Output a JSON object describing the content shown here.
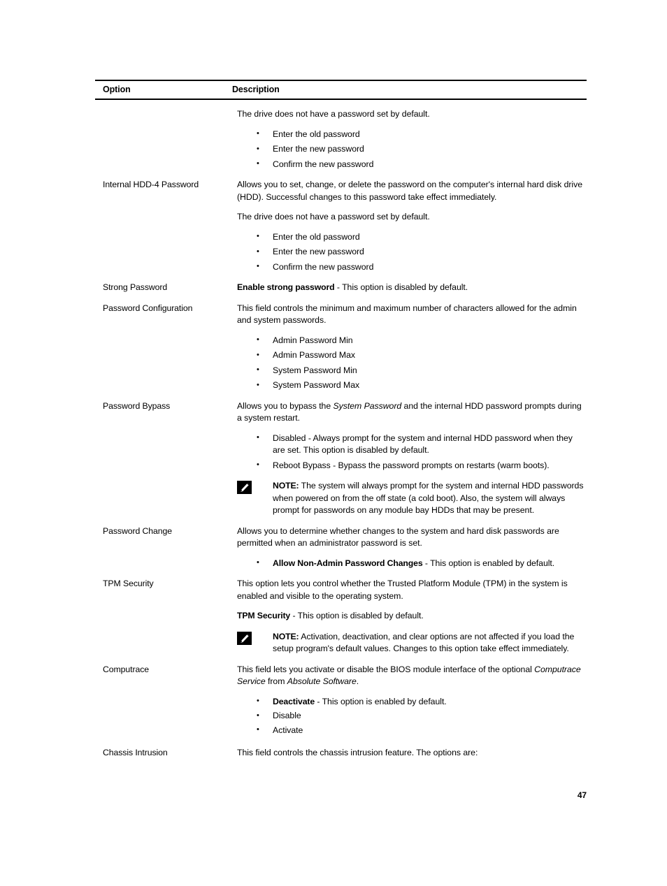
{
  "page": {
    "number": "47"
  },
  "table": {
    "headers": {
      "option": "Option",
      "description": "Description"
    },
    "rows": [
      {
        "option": "",
        "intro": "The drive does not have a password set by default.",
        "bullets": [
          "Enter the old password",
          "Enter the new password",
          "Confirm the new password"
        ]
      },
      {
        "option": "Internal HDD-4 Password",
        "para1": "Allows you to set, change, or delete the password on the computer's internal hard disk drive (HDD). Successful changes to this password take effect immediately.",
        "para2": "The drive does not have a password set by default.",
        "bullets": [
          "Enter the old password",
          "Enter the new password",
          "Confirm the new password"
        ]
      },
      {
        "option": "Strong Password",
        "bold_lead": "Enable strong password",
        "rest": " - This option is disabled by default."
      },
      {
        "option": "Password Configuration",
        "para1": "This field controls the minimum and maximum number of characters allowed for the admin and system passwords.",
        "bullets": [
          "Admin Password Min",
          "Admin Password Max",
          "System Password Min",
          "System Password Max"
        ]
      },
      {
        "option": "Password Bypass",
        "para_a": "Allows you to bypass the ",
        "para_italic": "System Password",
        "para_b": " and the internal HDD password prompts during a system restart.",
        "bullets": [
          "Disabled - Always prompt for the system and internal HDD password when they are set. This option is disabled by default.",
          "Reboot Bypass - Bypass the password prompts on restarts (warm boots)."
        ],
        "note_label": "NOTE:",
        "note_text": " The system will always prompt for the system and internal HDD passwords when powered on from the off state (a cold boot). Also, the system will always prompt for passwords on any module bay HDDs that may be present."
      },
      {
        "option": "Password Change",
        "para1": "Allows you to determine whether changes to the system and hard disk passwords are permitted when an administrator password is set.",
        "bullet_bold": "Allow Non-Admin Password Changes",
        "bullet_rest": " - This option is enabled by default."
      },
      {
        "option": "TPM Security",
        "para1": "This option lets you control whether the Trusted Platform Module (TPM) in the system is enabled and visible to the operating system.",
        "bold_lead": "TPM Security",
        "rest": " - This option is disabled by default.",
        "note_label": "NOTE:",
        "note_text": " Activation, deactivation, and clear options are not affected if you load the setup program's default values. Changes to this option take effect immediately."
      },
      {
        "option": "Computrace",
        "para_a": "This field lets you activate or disable the BIOS module interface of the optional ",
        "para_italic1": "Computrace Service",
        "para_b": " from ",
        "para_italic2": "Absolute Software",
        "para_c": ".",
        "bullet1_bold": "Deactivate",
        "bullet1_rest": " - This option is enabled by default.",
        "bullet2": "Disable",
        "bullet3": "Activate"
      },
      {
        "option": "Chassis Intrusion",
        "para1": "This field controls the chassis intrusion feature. The options are:"
      }
    ]
  },
  "icons": {
    "note": "note-pencil-icon"
  }
}
